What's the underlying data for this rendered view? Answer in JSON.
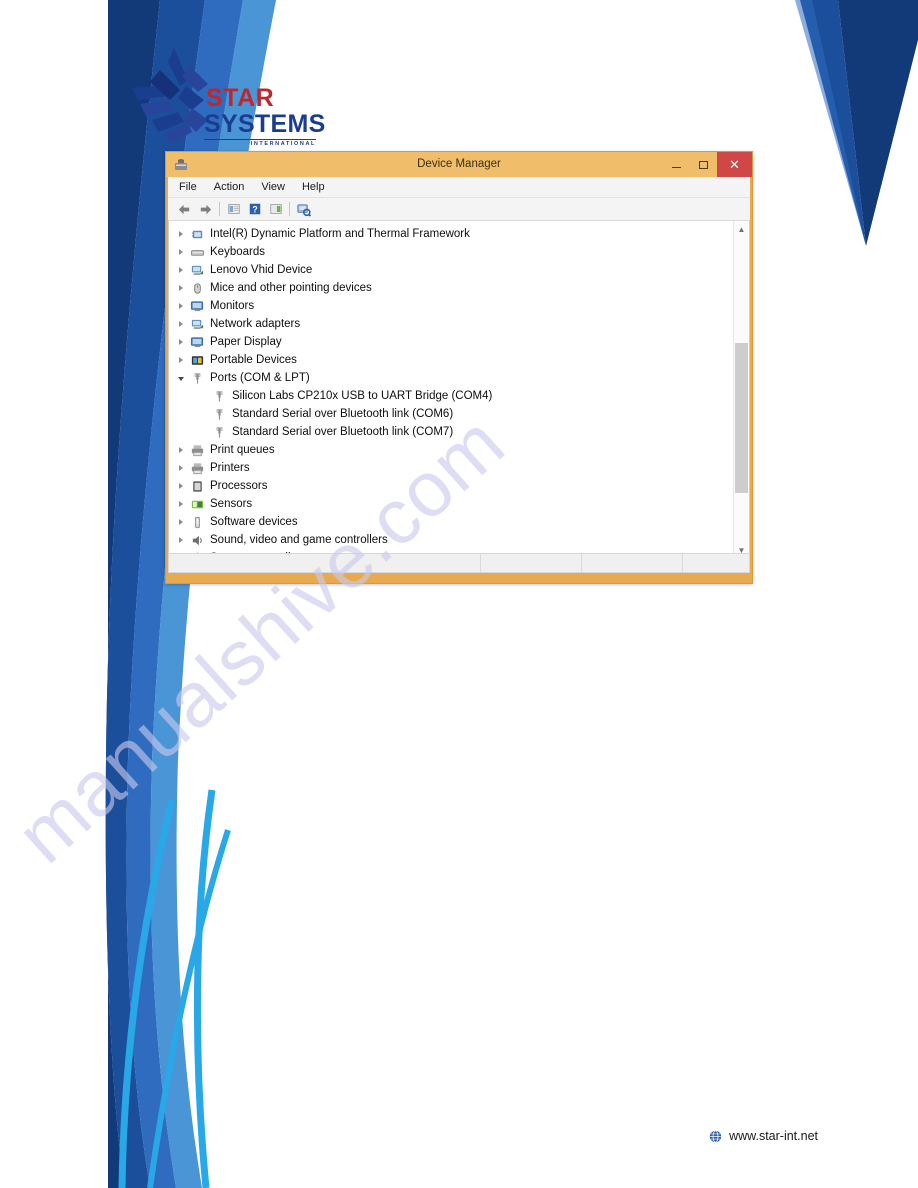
{
  "brand": {
    "logo_star": "STAR",
    "logo_systems": "SYSTEMS",
    "logo_international": "INTERNATIONAL",
    "star_color": "#c0272d",
    "systems_color": "#1b3d8f"
  },
  "page": {
    "watermark": "manualshive.com",
    "watermark_color": "#c9c9ee",
    "deco_navy": "#123a78",
    "deco_blue": "#1b4f9c",
    "deco_mid_blue": "#2f6cbf",
    "deco_light_blue": "#4a95d6",
    "deco_cyan": "#29a8e8"
  },
  "window": {
    "title": "Device Manager",
    "titlebar_color": "#f0bd6a",
    "frame_color": "#e7aa4e",
    "close_color": "#cf4747",
    "icon": "device-manager-icon",
    "controls": {
      "minimize": "minimize-button",
      "maximize": "maximize-button",
      "close_label": "✕"
    },
    "menu": [
      {
        "label": "File",
        "name": "menu-file"
      },
      {
        "label": "Action",
        "name": "menu-action"
      },
      {
        "label": "View",
        "name": "menu-view"
      },
      {
        "label": "Help",
        "name": "menu-help"
      }
    ],
    "toolbar": [
      {
        "name": "back-arrow-icon",
        "type": "back"
      },
      {
        "name": "forward-arrow-icon",
        "type": "forward"
      },
      {
        "name": "separator",
        "type": "sep"
      },
      {
        "name": "properties-icon",
        "type": "panel"
      },
      {
        "name": "help-icon",
        "type": "help"
      },
      {
        "name": "show-hidden-devices-icon",
        "type": "panel2"
      },
      {
        "name": "separator",
        "type": "sep"
      },
      {
        "name": "scan-hardware-changes-icon",
        "type": "scan"
      }
    ],
    "scrollbar": {
      "up_arrow": "▲",
      "down_arrow": "▼"
    }
  },
  "tree": {
    "items": [
      {
        "label": "Intel(R) Dynamic Platform and Thermal Framework",
        "icon": "chip-device-icon",
        "state": "collapsed",
        "level": 0
      },
      {
        "label": "Keyboards",
        "icon": "keyboard-icon",
        "state": "collapsed",
        "level": 0
      },
      {
        "label": "Lenovo Vhid Device",
        "icon": "network-device-icon",
        "state": "collapsed",
        "level": 0
      },
      {
        "label": "Mice and other pointing devices",
        "icon": "mouse-icon",
        "state": "collapsed",
        "level": 0
      },
      {
        "label": "Monitors",
        "icon": "monitor-icon",
        "state": "collapsed",
        "level": 0
      },
      {
        "label": "Network adapters",
        "icon": "network-device-icon",
        "state": "collapsed",
        "level": 0
      },
      {
        "label": "Paper Display",
        "icon": "monitor-icon",
        "state": "collapsed",
        "level": 0
      },
      {
        "label": "Portable Devices",
        "icon": "portable-device-icon",
        "state": "collapsed",
        "level": 0
      },
      {
        "label": "Ports (COM & LPT)",
        "icon": "port-icon",
        "state": "expanded",
        "level": 0
      },
      {
        "label": "Silicon Labs CP210x USB to UART Bridge (COM4)",
        "icon": "port-icon",
        "state": "leaf",
        "level": 1
      },
      {
        "label": "Standard Serial over Bluetooth link (COM6)",
        "icon": "port-icon",
        "state": "leaf",
        "level": 1
      },
      {
        "label": "Standard Serial over Bluetooth link (COM7)",
        "icon": "port-icon",
        "state": "leaf",
        "level": 1
      },
      {
        "label": "Print queues",
        "icon": "printer-icon",
        "state": "collapsed",
        "level": 0
      },
      {
        "label": "Printers",
        "icon": "printer-icon",
        "state": "collapsed",
        "level": 0
      },
      {
        "label": "Processors",
        "icon": "processor-icon",
        "state": "collapsed",
        "level": 0
      },
      {
        "label": "Sensors",
        "icon": "sensor-icon",
        "state": "collapsed",
        "level": 0
      },
      {
        "label": "Software devices",
        "icon": "software-device-icon",
        "state": "collapsed",
        "level": 0
      },
      {
        "label": "Sound, video and game controllers",
        "icon": "speaker-icon",
        "state": "collapsed",
        "level": 0
      },
      {
        "label": "Storage controllers",
        "icon": "storage-controller-icon",
        "state": "collapsed",
        "level": 0
      }
    ]
  },
  "footer": {
    "url": "www.star-int.net",
    "icon": "globe-icon"
  }
}
